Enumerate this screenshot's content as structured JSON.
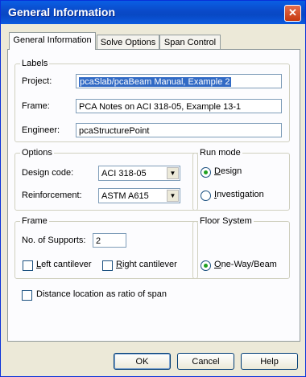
{
  "window": {
    "title": "General Information",
    "close_glyph": "✕"
  },
  "tabs": [
    {
      "label": "General Information"
    },
    {
      "label": "Solve Options"
    },
    {
      "label": "Span Control"
    }
  ],
  "labels_group": {
    "title": "Labels",
    "project_label": "Project:",
    "project_value": "pcaSlab/pcaBeam Manual, Example 2",
    "frame_label": "Frame:",
    "frame_value": "PCA Notes on ACI 318-05, Example 13-1",
    "engineer_label": "Engineer:",
    "engineer_value": "pcaStructurePoint"
  },
  "options_group": {
    "title": "Options",
    "design_code_label": "Design code:",
    "design_code_value": "ACI 318-05",
    "reinforcement_label": "Reinforcement:",
    "reinforcement_value": "ASTM A615"
  },
  "run_mode_group": {
    "title": "Run mode",
    "design_label": "Design",
    "design_checked": true,
    "investigation_label": "Investigation",
    "investigation_checked": false
  },
  "frame_group": {
    "title": "Frame",
    "supports_label": "No. of Supports:",
    "supports_value": "2",
    "left_cantilever_label": "Left cantilever",
    "right_cantilever_label": "Right cantilever"
  },
  "floor_group": {
    "title": "Floor System",
    "one_way_label": "One-Way/Beam"
  },
  "distance_checkbox_label": "Distance location as ratio of span",
  "buttons": {
    "ok": "OK",
    "cancel": "Cancel",
    "help": "Help"
  },
  "icons": {
    "dropdown": "chevron-down-icon",
    "close": "close-icon"
  },
  "colors": {
    "titlebar": "#0a4ac9",
    "selection": "#316ac5",
    "radio_dot": "#21a121"
  }
}
